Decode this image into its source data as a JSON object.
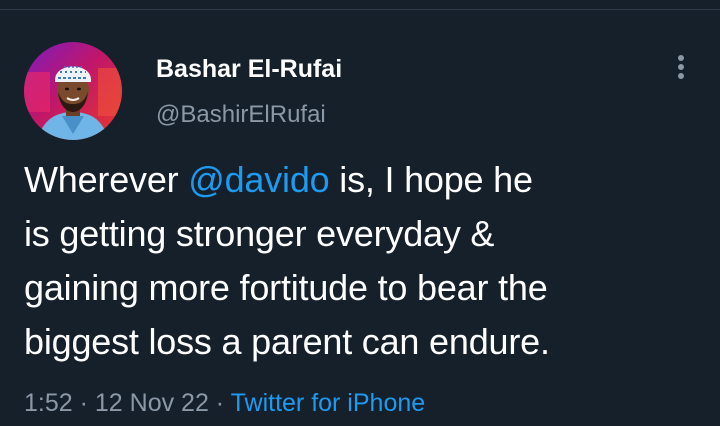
{
  "tweet": {
    "author": {
      "name": "Bashar El-Rufai",
      "handle": "@BashirElRufai"
    },
    "text": {
      "line1_before": "Wherever ",
      "line1_mention": "@davido",
      "line1_after": " is, I hope he",
      "line2": "is getting stronger everyday &",
      "line3": "gaining more fortitude to bear the",
      "line4": "biggest loss a parent can endure."
    },
    "meta": {
      "time": "1:52",
      "separator1": " · ",
      "date": "12 Nov 22",
      "separator2": " · ",
      "source": "Twitter for iPhone"
    },
    "colors": {
      "background": "#15202b",
      "text": "#ffffff",
      "secondary": "#8b98a5",
      "accent": "#1d9bf0"
    },
    "icons": {
      "more": "more-vertical-icon"
    }
  }
}
